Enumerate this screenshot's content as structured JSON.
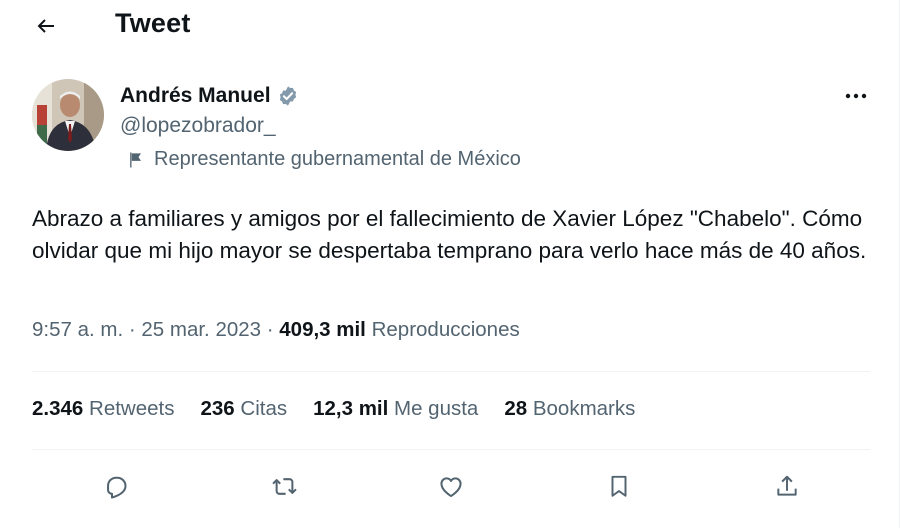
{
  "header": {
    "title": "Tweet",
    "back_icon": "arrow-left-icon"
  },
  "author": {
    "name": "Andrés Manuel",
    "handle": "@lopezobrador_",
    "verified_icon": "verified-badge-icon",
    "label": "Representante gubernamental de México",
    "label_icon": "flag-icon"
  },
  "tweet": {
    "text": "Abrazo a familiares y amigos por el fallecimiento de Xavier López \"Chabelo\". Cómo olvidar que mi hijo mayor se despertaba temprano para verlo hace más de 40 años.",
    "time": "9:57 a. m. · 25 mar. 2023 · ",
    "views_count": "409,3 mil",
    "views_label": " Reproducciones"
  },
  "stats": {
    "retweets": {
      "count": "2.346",
      "label": " Retweets"
    },
    "quotes": {
      "count": "236",
      "label": " Citas"
    },
    "likes": {
      "count": "12,3 mil",
      "label": " Me gusta"
    },
    "bookmarks": {
      "count": "28",
      "label": " Bookmarks"
    }
  },
  "actions": {
    "icons": [
      "reply-icon",
      "retweet-icon",
      "like-icon",
      "bookmark-icon",
      "share-icon"
    ]
  },
  "colors": {
    "text_primary": "#0f1419",
    "text_secondary": "#536471",
    "divider": "#eff3f4",
    "verified_badge": "#829aab"
  }
}
